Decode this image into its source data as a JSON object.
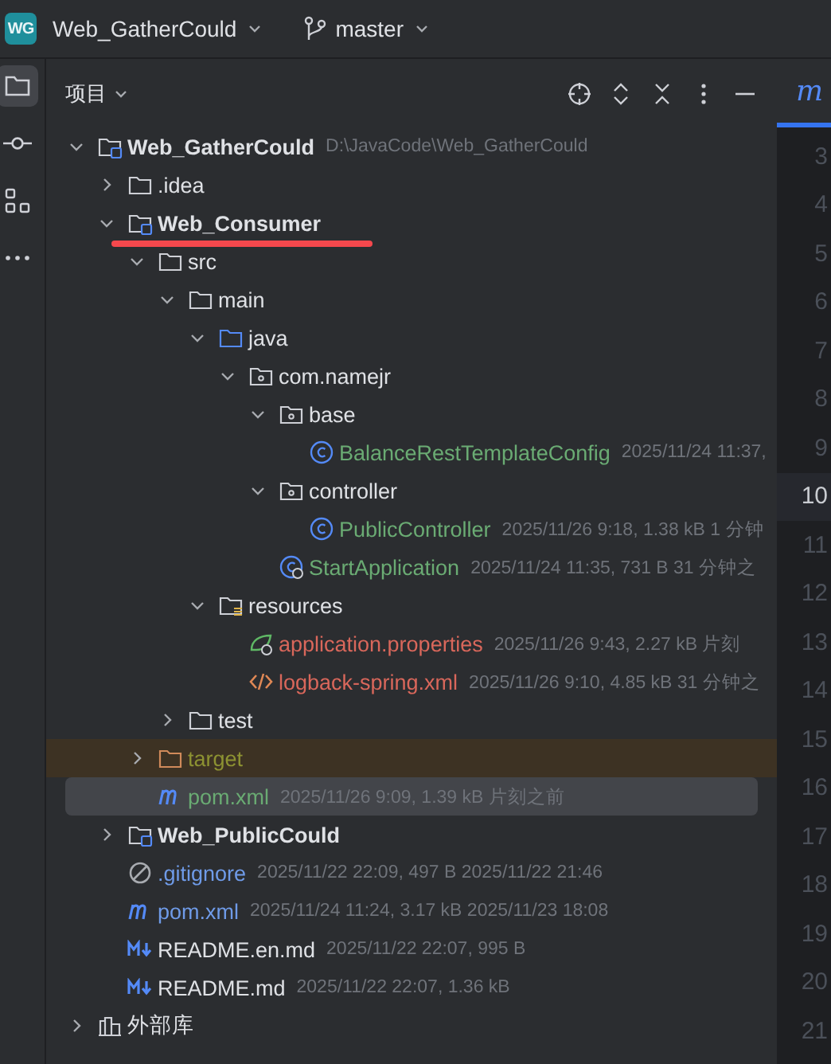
{
  "title_bar": {
    "project_badge": "WG",
    "project": "Web_GatherCould",
    "branch": "master"
  },
  "tool_strip": [
    {
      "kind": "project",
      "selected": true
    },
    {
      "kind": "commit",
      "selected": false
    },
    {
      "kind": "structure",
      "selected": false
    },
    {
      "kind": "more",
      "selected": false
    }
  ],
  "panel": {
    "title": "项目",
    "tree": [
      {
        "name": "Web_GatherCould",
        "kind": "module",
        "color": "#dfe1e5",
        "meta": "D:\\JavaCode\\Web_GatherCould",
        "expanded": true,
        "selected": false,
        "children": [
          {
            "name": ".idea",
            "kind": "folder",
            "color": "#dfe1e5",
            "expanded": false,
            "selected": false
          },
          {
            "name": "Web_Consumer",
            "kind": "module",
            "color": "#dfe1e5",
            "expanded": true,
            "selected": false,
            "underlined": true,
            "children": [
              {
                "name": "src",
                "kind": "folder",
                "color": "#dfe1e5",
                "expanded": true,
                "selected": false,
                "children": [
                  {
                    "name": "main",
                    "kind": "folder",
                    "color": "#dfe1e5",
                    "expanded": true,
                    "selected": false,
                    "children": [
                      {
                        "name": "java",
                        "kind": "source-folder",
                        "color": "#dfe1e5",
                        "expanded": true,
                        "selected": false,
                        "children": [
                          {
                            "name": "com.namejr",
                            "kind": "package",
                            "color": "#dfe1e5",
                            "expanded": true,
                            "selected": false,
                            "children": [
                              {
                                "name": "base",
                                "kind": "package",
                                "color": "#dfe1e5",
                                "expanded": true,
                                "selected": false,
                                "children": [
                                  {
                                    "name": "BalanceRestTemplateConfig",
                                    "kind": "class",
                                    "color": "#6aab73",
                                    "meta": "2025/11/24 11:37,",
                                    "selected": false
                                  }
                                ]
                              },
                              {
                                "name": "controller",
                                "kind": "package",
                                "color": "#dfe1e5",
                                "expanded": true,
                                "selected": false,
                                "children": [
                                  {
                                    "name": "PublicController",
                                    "kind": "class",
                                    "color": "#6aab73",
                                    "meta": "2025/11/26 9:18, 1.38 kB 1 分钟",
                                    "selected": false
                                  }
                                ]
                              },
                              {
                                "name": "StartApplication",
                                "kind": "boot-class",
                                "color": "#6aab73",
                                "meta": "2025/11/24 11:35, 731 B 31 分钟之",
                                "selected": false
                              }
                            ]
                          }
                        ]
                      },
                      {
                        "name": "resources",
                        "kind": "resources",
                        "color": "#dfe1e5",
                        "expanded": true,
                        "selected": false,
                        "children": [
                          {
                            "name": "application.properties",
                            "kind": "properties",
                            "color": "#d9675b",
                            "meta": "2025/11/26 9:43, 2.27 kB 片刻",
                            "selected": false
                          },
                          {
                            "name": "logback-spring.xml",
                            "kind": "xml",
                            "color": "#d9675b",
                            "meta": "2025/11/26 9:10, 4.85 kB 31 分钟之",
                            "selected": false
                          }
                        ]
                      }
                    ]
                  },
                  {
                    "name": "test",
                    "kind": "folder",
                    "color": "#dfe1e5",
                    "expanded": false,
                    "selected": false
                  }
                ]
              },
              {
                "name": "target",
                "kind": "excluded-folder",
                "color": "#8d9232",
                "expanded": false,
                "selected": false
              },
              {
                "name": "pom.xml",
                "kind": "maven",
                "color": "#6aab73",
                "meta": "2025/11/26 9:09, 1.39 kB 片刻之前",
                "selected": true
              }
            ]
          },
          {
            "name": "Web_PublicCould",
            "kind": "module",
            "color": "#dfe1e5",
            "expanded": false,
            "selected": false
          },
          {
            "name": ".gitignore",
            "kind": "gitignore",
            "color": "#6f9be8",
            "meta": "2025/11/22 22:09, 497 B 2025/11/22 21:46",
            "selected": false
          },
          {
            "name": "pom.xml",
            "kind": "maven",
            "color": "#6f9be8",
            "meta": "2025/11/24 11:24, 3.17 kB 2025/11/23 18:08",
            "selected": false
          },
          {
            "name": "README.en.md",
            "kind": "markdown",
            "color": "#dfe1e5",
            "meta": "2025/11/22 22:07, 995 B",
            "selected": false
          },
          {
            "name": "README.md",
            "kind": "markdown",
            "color": "#dfe1e5",
            "meta": "2025/11/22 22:07, 1.36 kB",
            "selected": false
          }
        ]
      },
      {
        "name": "外部库",
        "kind": "library",
        "color": "#dfe1e5",
        "expanded": false,
        "selected": false
      }
    ]
  },
  "editor": {
    "tab": "m",
    "lines": [
      {
        "number": "3",
        "current": false
      },
      {
        "number": "4",
        "current": false
      },
      {
        "number": "5",
        "current": false
      },
      {
        "number": "6",
        "current": false
      },
      {
        "number": "7",
        "current": false
      },
      {
        "number": "8",
        "current": false
      },
      {
        "number": "9",
        "current": false
      },
      {
        "number": "10",
        "current": true
      },
      {
        "number": "11",
        "current": false
      },
      {
        "number": "12",
        "current": false
      },
      {
        "number": "13",
        "current": false
      },
      {
        "number": "14",
        "current": false
      },
      {
        "number": "15",
        "current": false
      },
      {
        "number": "16",
        "current": false
      },
      {
        "number": "17",
        "current": false
      },
      {
        "number": "18",
        "current": false
      },
      {
        "number": "19",
        "current": false
      },
      {
        "number": "20",
        "current": false
      },
      {
        "number": "21",
        "current": false
      }
    ]
  }
}
